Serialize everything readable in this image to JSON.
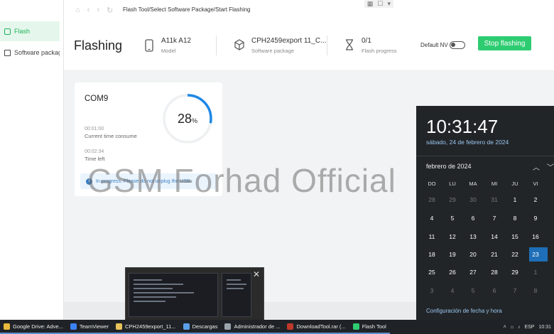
{
  "sidebar": {
    "items": [
      {
        "label": "Flash"
      },
      {
        "label": "Software packag..."
      }
    ]
  },
  "pathbar": {
    "path": "Flash Tool/Select Software Package/Start Flashing"
  },
  "header": {
    "title": "Flashing",
    "model_value": "A11k A12",
    "model_label": "Model",
    "package_value": "CPH2459export 11_C...",
    "package_label": "Software package",
    "progress_value": "0/1",
    "progress_label": "Flash progress",
    "default_nv_label": "Default NV",
    "default_nv_on": false,
    "stop_label": "Stop flashing",
    "accent": "#2ecc71"
  },
  "card": {
    "port": "COM9",
    "percent": "28",
    "percent_unit": "%",
    "progress_fraction": 0.28,
    "consume_value": "00:01:00",
    "consume_label": "Current time consume",
    "left_value": "00:02:34",
    "left_label": "Time left",
    "notice": "In progress. Please do not unplug the USB."
  },
  "watermark": "GSM Forhad Official",
  "calendar": {
    "time": "10:31:47",
    "date_long": "sábado, 24 de febrero de 2024",
    "month": "febrero de 2024",
    "weekdays": [
      "DO",
      "LU",
      "MA",
      "MI",
      "JU",
      "VI"
    ],
    "rows": [
      [
        "28",
        "29",
        "30",
        "31",
        "1",
        "2"
      ],
      [
        "4",
        "5",
        "6",
        "7",
        "8",
        "9"
      ],
      [
        "11",
        "12",
        "13",
        "14",
        "15",
        "16"
      ],
      [
        "18",
        "19",
        "20",
        "21",
        "22",
        "23"
      ],
      [
        "25",
        "26",
        "27",
        "28",
        "29",
        "1"
      ],
      [
        "3",
        "4",
        "5",
        "6",
        "7",
        "8"
      ]
    ],
    "footer": "Configuración de fecha y hora"
  },
  "taskbar": {
    "items": [
      {
        "label": "Google Drive: Adve...",
        "color": "#e8b93a"
      },
      {
        "label": "TeamViewer",
        "color": "#3b82f6"
      },
      {
        "label": "CPH2459export_11...",
        "color": "#e8c35a"
      },
      {
        "label": "Descargas",
        "color": "#5aa0e8"
      },
      {
        "label": "Administrador de ...",
        "color": "#9aa4ad"
      },
      {
        "label": "DownloadTool.rar (...",
        "color": "#c0392b"
      },
      {
        "label": "Flash Tool",
        "color": "#2ecc71"
      }
    ],
    "lang": "ESP",
    "clock": "10:31"
  }
}
